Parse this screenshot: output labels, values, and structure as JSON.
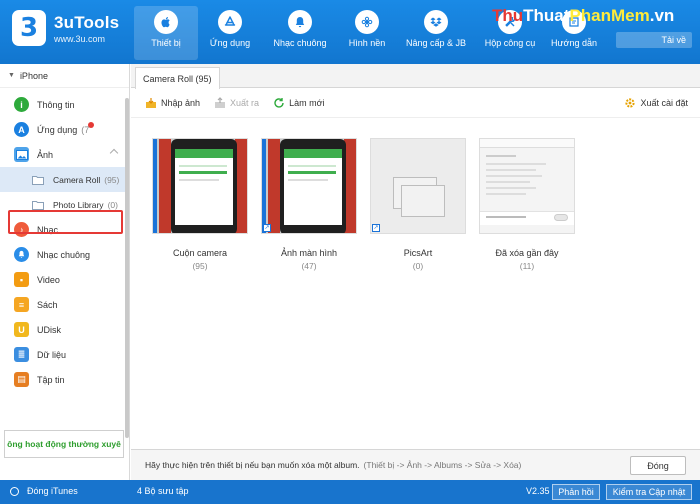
{
  "app": {
    "name": "3uTools",
    "url": "www.3u.com",
    "logo_glyph": "3"
  },
  "nav": [
    {
      "label": "Thiết bị",
      "icon": "apple-icon",
      "active": true
    },
    {
      "label": "Ứng dụng",
      "icon": "app-store-icon"
    },
    {
      "label": "Nhạc chuông",
      "icon": "bell-icon"
    },
    {
      "label": "Hình nền",
      "icon": "flower-icon"
    },
    {
      "label": "Nâng cấp & JB",
      "icon": "dropbox-icon"
    },
    {
      "label": "Hộp công cụ",
      "icon": "tools-icon"
    },
    {
      "label": "Hướng dẫn",
      "icon": "guide-icon"
    }
  ],
  "watermark": {
    "a": "Thu",
    "b": "Thuat",
    "c": "PhanMem",
    "d": ".vn"
  },
  "download_label": "Tải về",
  "sidebar": {
    "device": "iPhone",
    "items": [
      {
        "label": "Thông tin",
        "icon": "info-icon",
        "color": "#2eaa3c"
      },
      {
        "label": "Ứng dụng",
        "count": "(7",
        "icon": "app-store-icon",
        "color": "#1a80e0"
      },
      {
        "label": "Ảnh",
        "icon": "photo-icon",
        "color": "#1a80e0"
      },
      {
        "label": "Camera Roll",
        "count": "(95)",
        "icon": "folder-icon",
        "sub": true,
        "selected": true
      },
      {
        "label": "Photo Library",
        "count": "(0)",
        "icon": "folder-icon",
        "sub": true
      },
      {
        "label": "Nhạc",
        "icon": "music-icon",
        "color": "#ef5b3b"
      },
      {
        "label": "Nhạc chuông",
        "icon": "bell-icon",
        "color": "#2a8de8"
      },
      {
        "label": "Video",
        "icon": "video-icon",
        "color": "#f39c12"
      },
      {
        "label": "Sách",
        "icon": "book-icon",
        "color": "#f5a623"
      },
      {
        "label": "UDisk",
        "icon": "udisk-icon",
        "color": "#f1b81e"
      },
      {
        "label": "Dữ liệu",
        "icon": "data-icon",
        "color": "#3b8ee0"
      },
      {
        "label": "Tập tin",
        "icon": "file-icon",
        "color": "#e67e22"
      }
    ],
    "marquee": "ông hoạt động thường xuyê"
  },
  "main": {
    "tab": "Camera Roll (95)",
    "toolbar": {
      "import": "Nhập ảnh",
      "export": "Xuất ra",
      "refresh": "Làm mới",
      "settings": "Xuất cài đặt"
    },
    "albums": [
      {
        "name": "Cuộn camera",
        "count": "(95)",
        "thumb": "phone"
      },
      {
        "name": "Ảnh màn hình",
        "count": "(47)",
        "thumb": "phone"
      },
      {
        "name": "PicsArt",
        "count": "(0)",
        "thumb": "empty"
      },
      {
        "name": "Đã xóa gần đây",
        "count": "(11)",
        "thumb": "settings"
      }
    ],
    "hint": "Hãy thực hiện trên thiết bị nếu bạn muốn xóa một album.",
    "hint_path": "(Thiết bị -> Ảnh -> Albums -> Sửa -> Xóa)",
    "close_label": "Đóng"
  },
  "status": {
    "itunes": "Đóng iTunes",
    "collections": "4 Bộ sưu tập",
    "version": "V2.35",
    "feedback": "Phản hồi",
    "update": "Kiểm tra Cập nhật"
  }
}
